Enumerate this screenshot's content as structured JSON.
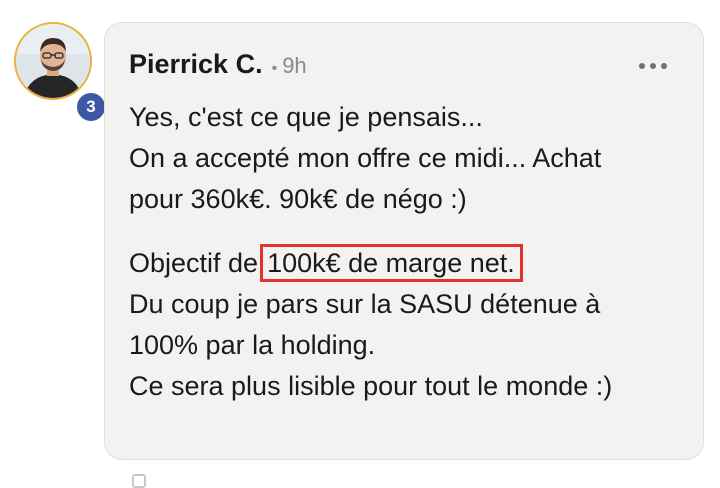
{
  "comment": {
    "author": "Pierrick C.",
    "separator": "•",
    "time": "9h",
    "badge_count": "3",
    "lines": {
      "l1": "Yes, c'est ce que je pensais...",
      "l2": "On a accepté mon offre ce midi... Achat",
      "l3": "pour 360k€. 90k€ de négo :)",
      "l4_prefix": "Objectif de",
      "l4_highlight": "100k€ de marge net.",
      "l5": "Du coup je pars sur la SASU détenue à",
      "l6": "100% par la holding.",
      "l7": "Ce sera plus lisible pour tout le monde :)"
    }
  },
  "icons": {
    "more": "more-horizontal-icon",
    "avatar": "avatar-photo"
  },
  "colors": {
    "bubble_bg": "#f4f2f0",
    "badge_bg": "#3f58a6",
    "highlight_border": "#e0332b",
    "avatar_ring": "#e9b23c"
  }
}
